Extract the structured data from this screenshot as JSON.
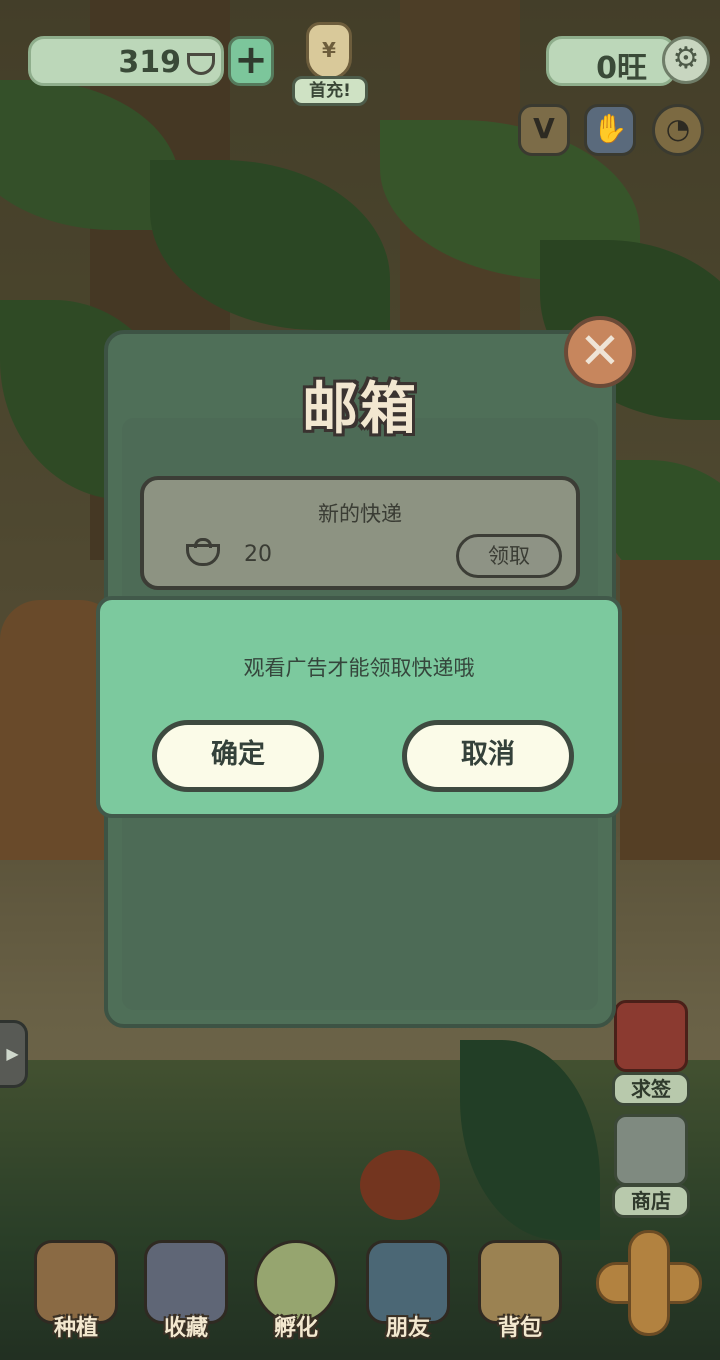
{
  "hud": {
    "coins": "319",
    "coin_icon": "ingot-icon",
    "plus_label": "+",
    "first_charge_label": "首充!",
    "first_charge_symbol": "¥",
    "score": "0旺",
    "settings_icon": "gear-icon",
    "vip_label": "V",
    "hand_icon": "hand-icon",
    "fan_icon": "fan-icon"
  },
  "mailbox": {
    "title": "邮箱",
    "close_label": "✕",
    "items": [
      {
        "title": "新的快递",
        "icon": "ingot-icon",
        "amount": "20",
        "action": "领取"
      }
    ]
  },
  "dialog": {
    "message": "观看广告才能领取快递哦",
    "confirm": "确定",
    "cancel": "取消"
  },
  "side": {
    "arrow": "▶",
    "fortune_label": "求签",
    "shop_label": "商店"
  },
  "nav": {
    "plant": "种植",
    "collect": "收藏",
    "hatch": "孵化",
    "friends": "朋友",
    "bag": "背包"
  },
  "colors": {
    "panel": "#4f6f58",
    "dialog": "#7cc99e",
    "button_fill": "#fbfbe8",
    "close_button": "#c7865d"
  }
}
